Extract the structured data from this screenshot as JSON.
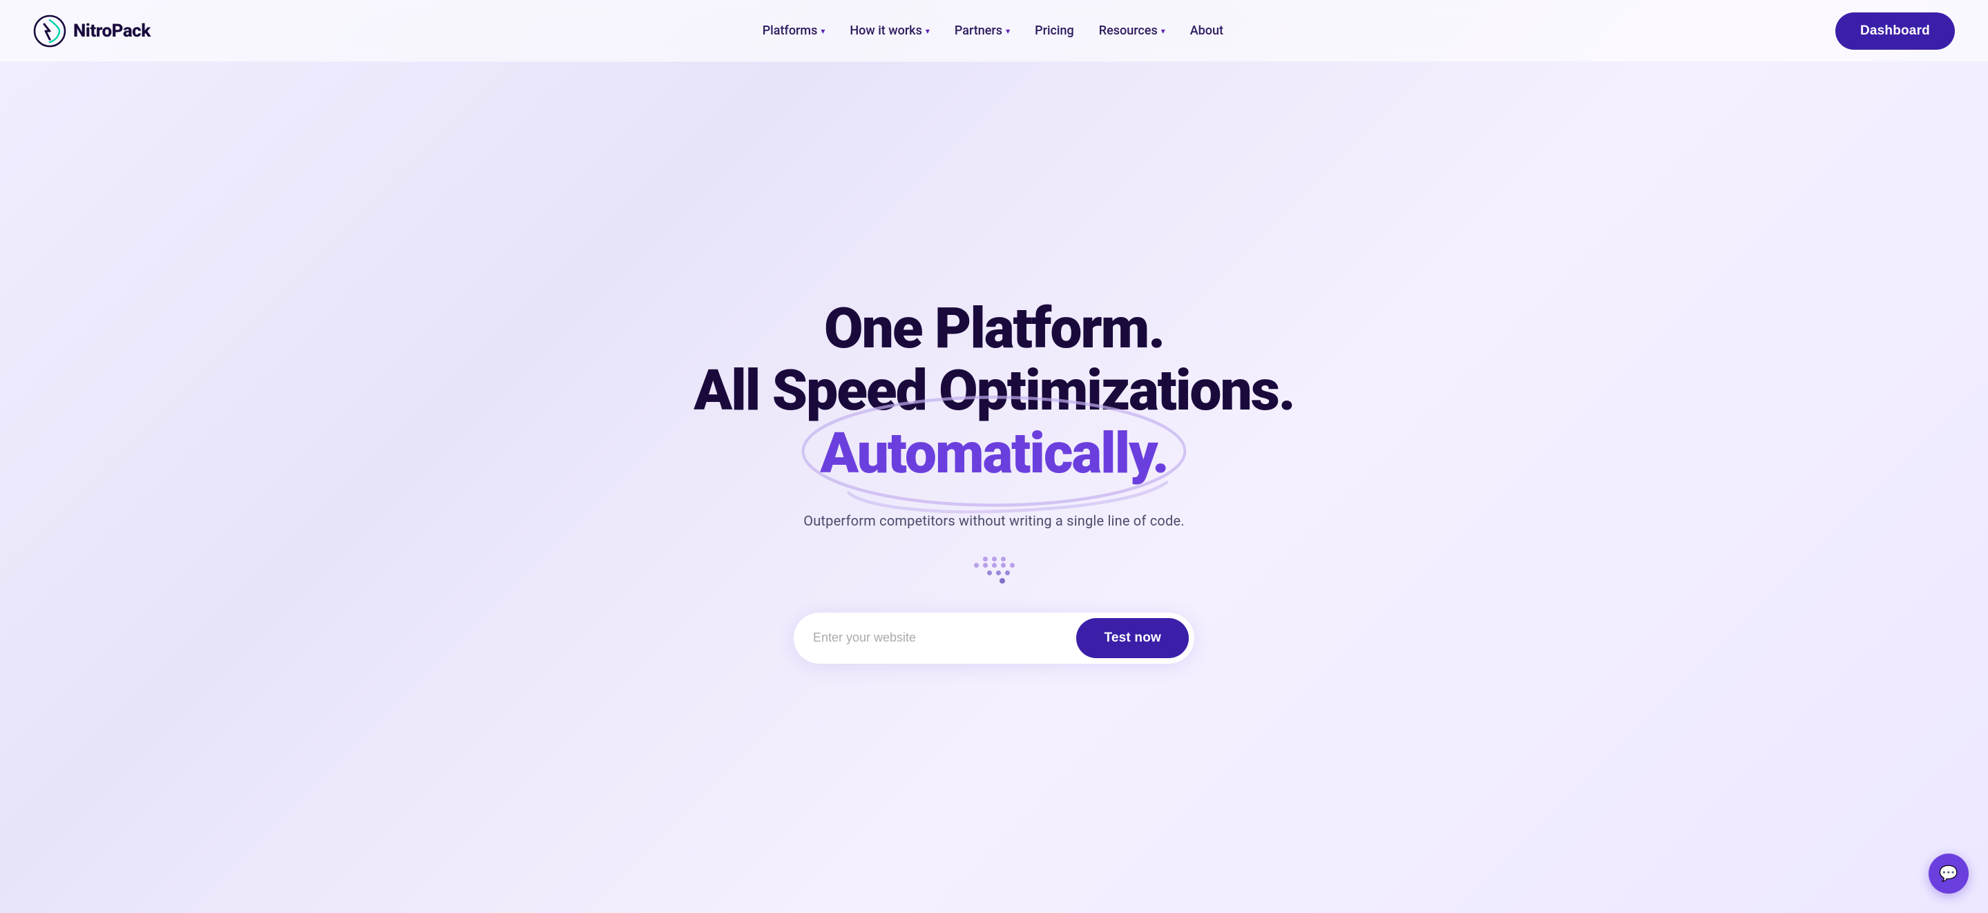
{
  "logo": {
    "text": "NitroPack",
    "icon_name": "nitropack-logo-icon"
  },
  "nav": {
    "links": [
      {
        "label": "Platforms",
        "has_dropdown": true
      },
      {
        "label": "How it works",
        "has_dropdown": true
      },
      {
        "label": "Partners",
        "has_dropdown": true
      },
      {
        "label": "Pricing",
        "has_dropdown": false
      },
      {
        "label": "Resources",
        "has_dropdown": true
      },
      {
        "label": "About",
        "has_dropdown": false
      }
    ],
    "dashboard_button": "Dashboard"
  },
  "hero": {
    "line1": "One Platform.",
    "line2": "All Speed Optimizations.",
    "line3": "Automatically.",
    "subtitle": "Outperform competitors without writing a single line of code.",
    "cta_placeholder": "Enter your website",
    "cta_button": "Test now"
  },
  "chat": {
    "icon": "💬"
  },
  "colors": {
    "brand_dark": "#1a0a3c",
    "brand_purple": "#6b3fdd",
    "brand_button": "#3b1fa8",
    "accent": "#b8a0e8"
  }
}
